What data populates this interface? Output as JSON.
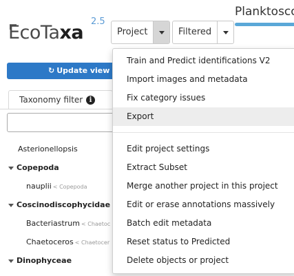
{
  "app": {
    "logo_text_thin": "EcoTa",
    "logo_text_bold": "xa",
    "version": "2.5"
  },
  "header": {
    "project_title": "Planktosco",
    "project_dropdown_label": "Project",
    "filtered_dropdown_label": "Filtered"
  },
  "left_panel": {
    "update_button_label": "Update view &",
    "taxonomy_tab_label": "Taxonomy filter",
    "filter_input_value": "",
    "taxa": [
      {
        "name": "Asterionellopsis",
        "parent": "",
        "kind": "leaf"
      },
      {
        "name": "Copepoda",
        "parent": "",
        "kind": "group"
      },
      {
        "name": "nauplii",
        "parent": "< Copepoda",
        "kind": "child"
      },
      {
        "name": "Coscinodiscophycidae",
        "parent": "",
        "kind": "group"
      },
      {
        "name": "Bacteriastrum",
        "parent": "< Chaetoc",
        "kind": "child"
      },
      {
        "name": "Chaetoceros",
        "parent": "< Chaetocer",
        "kind": "child"
      },
      {
        "name": "Dinophyceae",
        "parent": "",
        "kind": "group"
      }
    ]
  },
  "project_menu": {
    "group1": [
      "Train and Predict identifications V2",
      "Import images and metadata",
      "Fix category issues",
      "Export"
    ],
    "group2": [
      "Edit project settings",
      "Extract Subset",
      "Merge another project in this project",
      "Edit or erase annotations massively",
      "Batch edit metadata",
      "Reset status to Predicted",
      "Delete objects or project"
    ],
    "highlighted_item": "Export"
  },
  "colors": {
    "accent": "#2d79c7",
    "version_blue": "#5b9bd5",
    "title_underline": "#5aa8d8"
  },
  "icons": {
    "update_button": "sync-icon",
    "taxonomy_tab": "info-circle-icon",
    "tree_toggle": "caret-down-icon"
  }
}
